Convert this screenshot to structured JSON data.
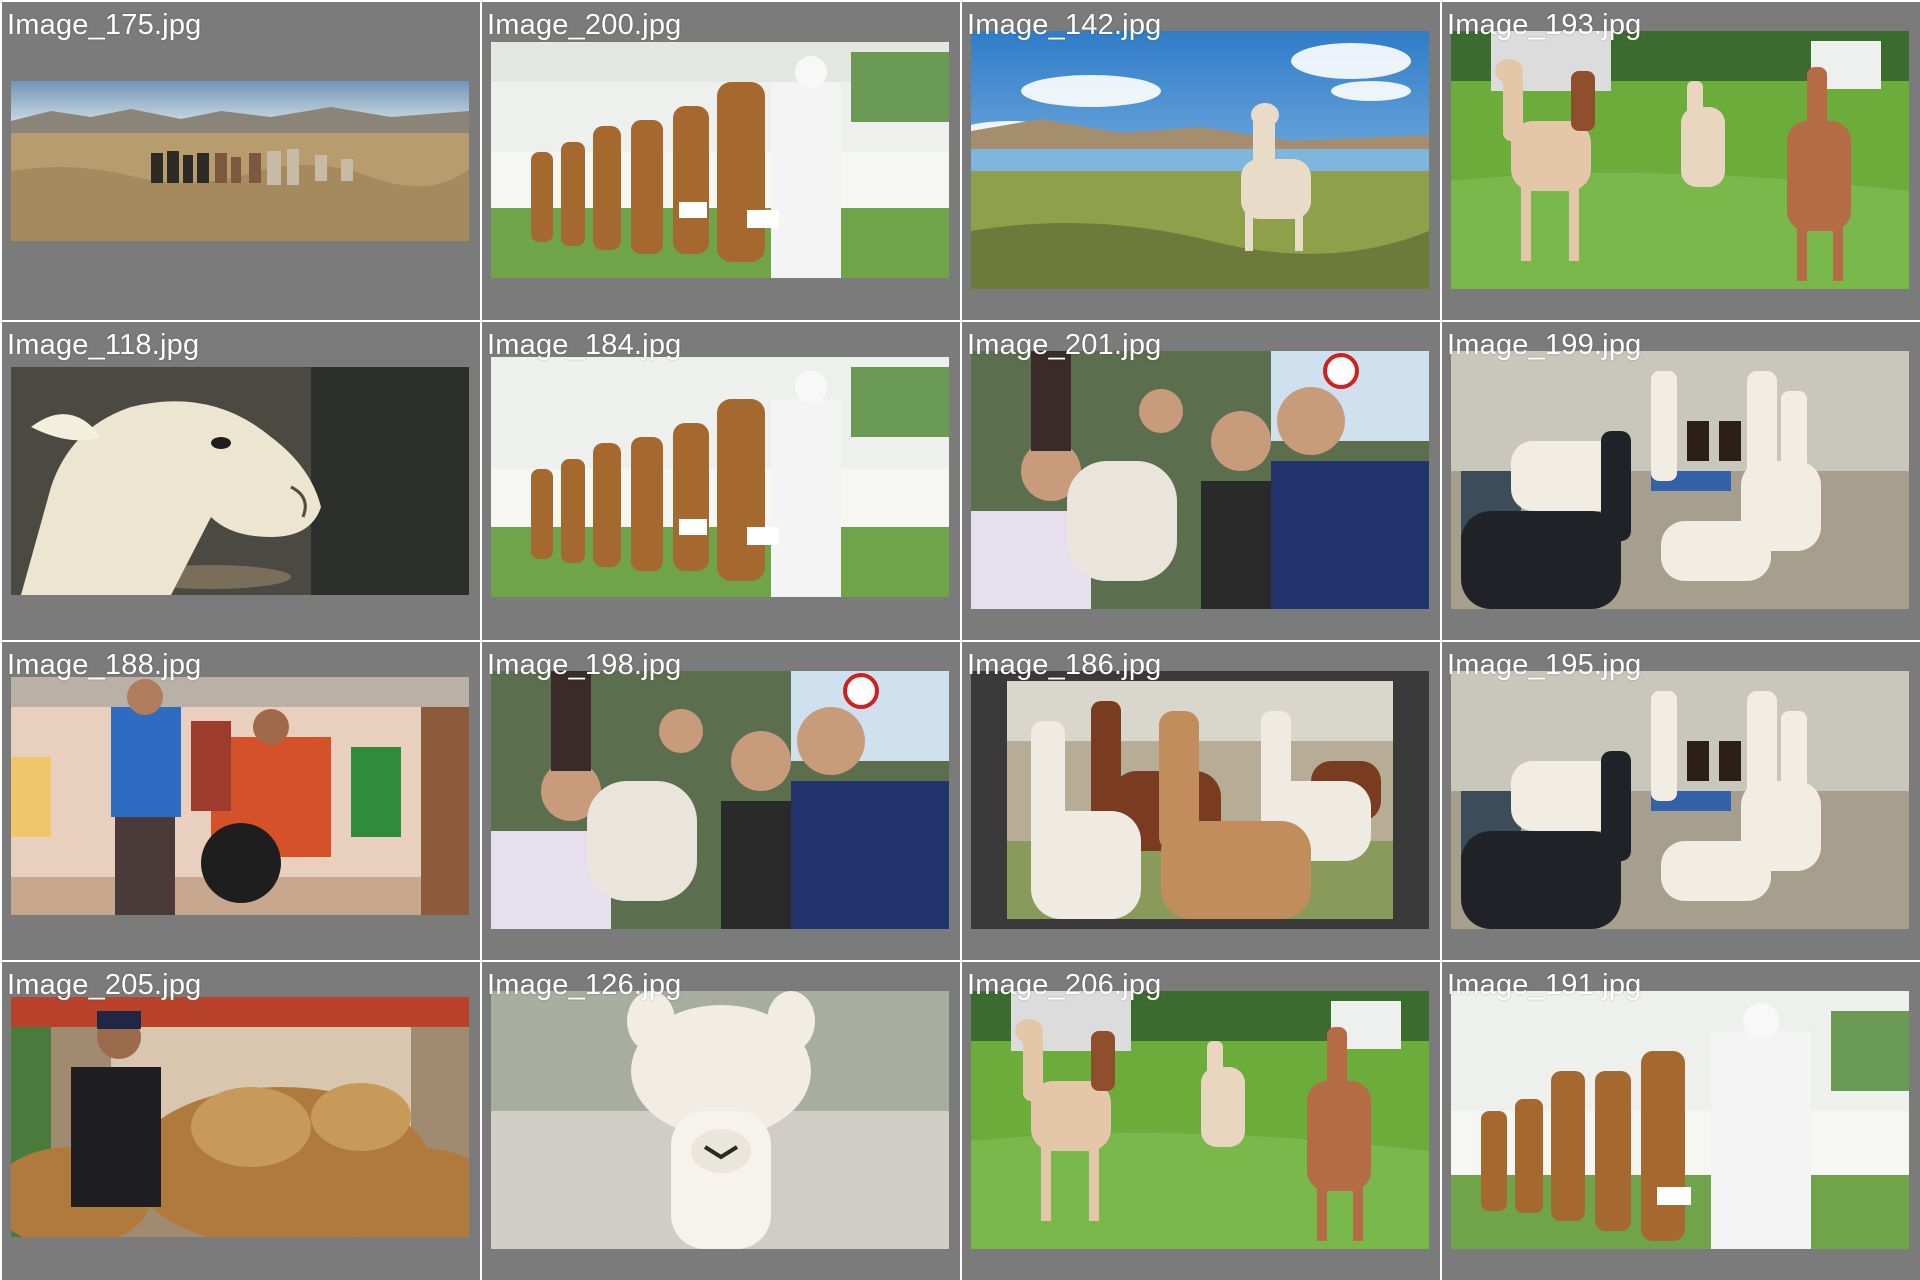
{
  "gallery": {
    "tiles": [
      {
        "filename": "Image_175.jpg",
        "scene": "alpaca-herd-plains"
      },
      {
        "filename": "Image_200.jpg",
        "scene": "alpaca-show-ring"
      },
      {
        "filename": "Image_142.jpg",
        "scene": "alpaca-lake-landscape"
      },
      {
        "filename": "Image_193.jpg",
        "scene": "alpacas-green-pasture"
      },
      {
        "filename": "Image_118.jpg",
        "scene": "alpaca-head-closeup"
      },
      {
        "filename": "Image_184.jpg",
        "scene": "alpaca-show-ring"
      },
      {
        "filename": "Image_201.jpg",
        "scene": "crowd-with-alpaca"
      },
      {
        "filename": "Image_199.jpg",
        "scene": "alpacas-in-barn"
      },
      {
        "filename": "Image_188.jpg",
        "scene": "weavers-in-village"
      },
      {
        "filename": "Image_198.jpg",
        "scene": "crowd-with-alpaca"
      },
      {
        "filename": "Image_186.jpg",
        "scene": "alpaca-group-field"
      },
      {
        "filename": "Image_195.jpg",
        "scene": "alpacas-in-barn"
      },
      {
        "filename": "Image_205.jpg",
        "scene": "wool-market"
      },
      {
        "filename": "Image_126.jpg",
        "scene": "fluffy-alpaca-portrait"
      },
      {
        "filename": "Image_206.jpg",
        "scene": "alpacas-green-pasture"
      },
      {
        "filename": "Image_191.jpg",
        "scene": "alpaca-show-ring"
      }
    ]
  }
}
